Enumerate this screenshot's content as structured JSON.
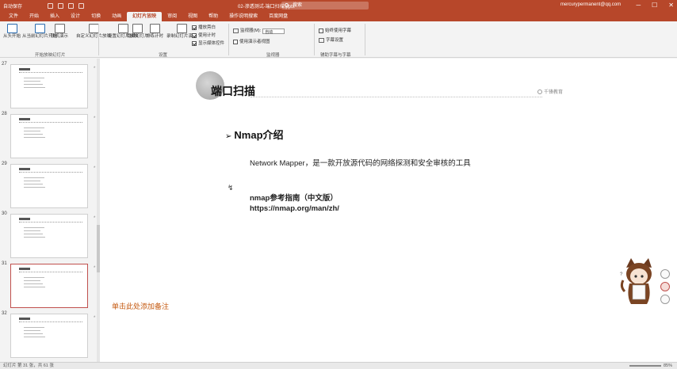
{
  "titlebar": {
    "autosave": "自动保存",
    "filename": "02-渗透测试-端口扫描.pptx",
    "search_placeholder": "搜索",
    "user": "mercurypermanent@qq.com",
    "minimize": "─",
    "maximize": "☐",
    "close": "✕"
  },
  "tabs": [
    "文件",
    "开始",
    "插入",
    "设计",
    "切换",
    "动画",
    "幻灯片放映",
    "审阅",
    "视图",
    "帮助",
    "操作说明搜索",
    "百度网盘"
  ],
  "active_tab": "幻灯片放映",
  "ribbon": {
    "from_start": "从头开始",
    "from_current": "从当前幻灯片开始",
    "online_present": "联机演示",
    "custom_show": "自定义幻灯片放映",
    "setup_show": "设置幻灯片放映",
    "hide_slide": "隐藏幻灯片",
    "rehearse": "排练计时",
    "record": "录制幻灯片演示",
    "play_narrations": "播放旁白",
    "use_timings": "使用计时",
    "show_media_controls": "显示媒体控件",
    "monitor_label": "监视器(M):",
    "monitor_value": "自动",
    "presenter_view": "使用演示者视图",
    "always_subtitles": "始终使用字幕",
    "subtitle_settings": "字幕设置",
    "group_start": "开始放映幻灯片",
    "group_setup": "设置",
    "group_monitors": "监视器",
    "group_captions": "辅助字幕与字幕"
  },
  "thumbnails": [
    {
      "num": "27",
      "selected": false
    },
    {
      "num": "28",
      "selected": false
    },
    {
      "num": "29",
      "selected": false
    },
    {
      "num": "30",
      "selected": false
    },
    {
      "num": "31",
      "selected": true
    },
    {
      "num": "32",
      "selected": false
    }
  ],
  "slide": {
    "title": "端口扫描",
    "watermark": "千锋教育",
    "heading_arrow": "➢",
    "heading": "Nmap介绍",
    "description": "Network Mapper，是一款开放源代码的网络探测和安全审核的工具",
    "ref_title": "nmap参考指南（中文版）",
    "ref_url": "https://nmap.org/man/zh/",
    "cursor": "↯"
  },
  "notes_placeholder": "单击此处添加备注",
  "statusbar": {
    "left": "幻灯片 第 31 张，共 61 张",
    "zoom": "85%"
  },
  "colors": {
    "brand": "#b7472a",
    "notes_hint": "#c55a11",
    "selected_thumb_border": "#c0504d"
  }
}
